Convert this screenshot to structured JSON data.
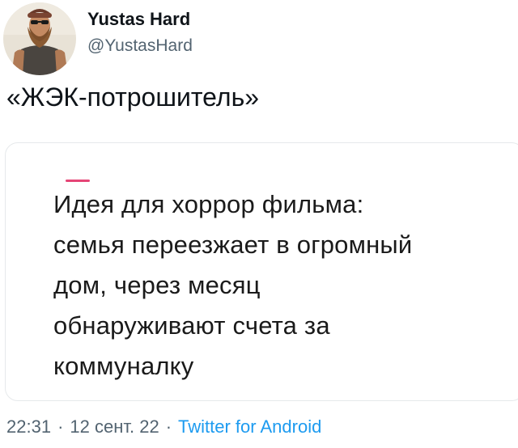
{
  "author": {
    "display_name": "Yustas Hard",
    "handle": "@YustasHard",
    "avatar_icon": "bearded-man-avatar"
  },
  "tweet": {
    "text": "«ЖЭК-потрошитель»"
  },
  "quoted": {
    "lines": [
      "Идея для хоррор фильма:",
      "семья переезжает в огромный",
      "дом, через месяц",
      "обнаруживают счета за",
      "коммуналку"
    ]
  },
  "meta": {
    "time": "22:31",
    "separator": "·",
    "date": "12 сент. 22",
    "source": "Twitter for Android"
  },
  "colors": {
    "text": "#0f1419",
    "secondary": "#536471",
    "link": "#1d9bf0",
    "quote_border": "#e6e9eb"
  }
}
